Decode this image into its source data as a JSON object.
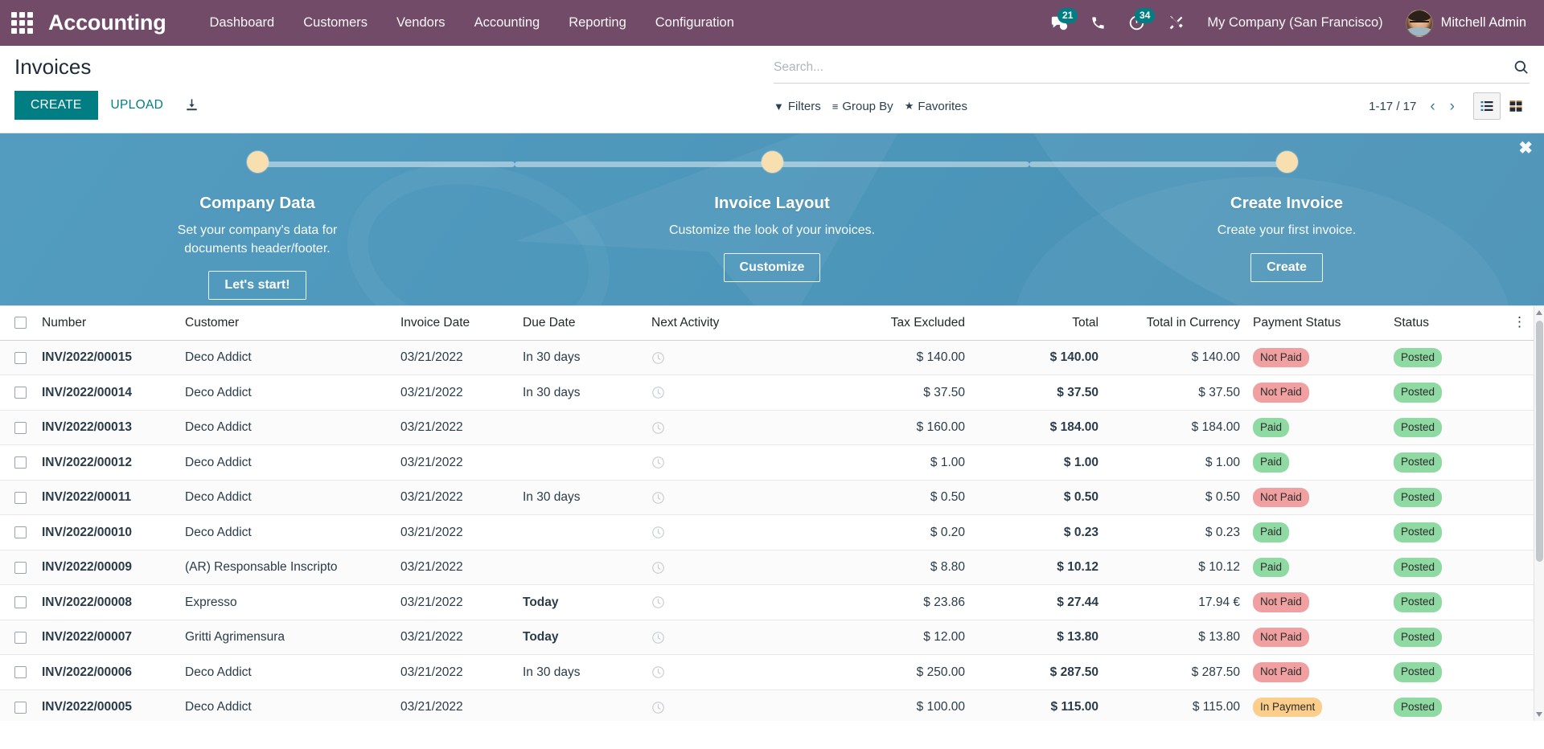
{
  "navbar": {
    "apps_icon": "apps-grid-icon",
    "brand": "Accounting",
    "menus": [
      {
        "label": "Dashboard"
      },
      {
        "label": "Customers"
      },
      {
        "label": "Vendors"
      },
      {
        "label": "Accounting"
      },
      {
        "label": "Reporting"
      },
      {
        "label": "Configuration"
      }
    ],
    "messages_count": "21",
    "activities_count": "34",
    "company": "My Company (San Francisco)",
    "user": "Mitchell Admin"
  },
  "control_panel": {
    "title": "Invoices",
    "create_label": "CREATE",
    "upload_label": "UPLOAD",
    "search_placeholder": "Search...",
    "filters_label": "Filters",
    "group_by_label": "Group By",
    "favorites_label": "Favorites",
    "pager": "1-17 / 17",
    "prev_arrow": "‹",
    "next_arrow": "›"
  },
  "onboarding": {
    "close_label": "✖",
    "steps": [
      {
        "title": "Company Data",
        "desc": "Set your company's data for documents header/footer.",
        "button": "Let's start!"
      },
      {
        "title": "Invoice Layout",
        "desc": "Customize the look of your invoices.",
        "button": "Customize"
      },
      {
        "title": "Create Invoice",
        "desc": "Create your first invoice.",
        "button": "Create"
      }
    ]
  },
  "table": {
    "columns": [
      "Number",
      "Customer",
      "Invoice Date",
      "Due Date",
      "Next Activity",
      "Tax Excluded",
      "Total",
      "Total in Currency",
      "Payment Status",
      "Status"
    ],
    "rows": [
      {
        "number": "INV/2022/00015",
        "customer": "Deco Addict",
        "invoice_date": "03/21/2022",
        "due_date": "In 30 days",
        "due_today": false,
        "tax_excluded": "$ 140.00",
        "total": "$ 140.00",
        "total_currency": "$ 140.00",
        "payment_status": "Not Paid",
        "payment_class": "notpaid",
        "status": "Posted"
      },
      {
        "number": "INV/2022/00014",
        "customer": "Deco Addict",
        "invoice_date": "03/21/2022",
        "due_date": "In 30 days",
        "due_today": false,
        "tax_excluded": "$ 37.50",
        "total": "$ 37.50",
        "total_currency": "$ 37.50",
        "payment_status": "Not Paid",
        "payment_class": "notpaid",
        "status": "Posted"
      },
      {
        "number": "INV/2022/00013",
        "customer": "Deco Addict",
        "invoice_date": "03/21/2022",
        "due_date": "",
        "due_today": false,
        "tax_excluded": "$ 160.00",
        "total": "$ 184.00",
        "total_currency": "$ 184.00",
        "payment_status": "Paid",
        "payment_class": "paid",
        "status": "Posted"
      },
      {
        "number": "INV/2022/00012",
        "customer": "Deco Addict",
        "invoice_date": "03/21/2022",
        "due_date": "",
        "due_today": false,
        "tax_excluded": "$ 1.00",
        "total": "$ 1.00",
        "total_currency": "$ 1.00",
        "payment_status": "Paid",
        "payment_class": "paid",
        "status": "Posted"
      },
      {
        "number": "INV/2022/00011",
        "customer": "Deco Addict",
        "invoice_date": "03/21/2022",
        "due_date": "In 30 days",
        "due_today": false,
        "tax_excluded": "$ 0.50",
        "total": "$ 0.50",
        "total_currency": "$ 0.50",
        "payment_status": "Not Paid",
        "payment_class": "notpaid",
        "status": "Posted"
      },
      {
        "number": "INV/2022/00010",
        "customer": "Deco Addict",
        "invoice_date": "03/21/2022",
        "due_date": "",
        "due_today": false,
        "tax_excluded": "$ 0.20",
        "total": "$ 0.23",
        "total_currency": "$ 0.23",
        "payment_status": "Paid",
        "payment_class": "paid",
        "status": "Posted"
      },
      {
        "number": "INV/2022/00009",
        "customer": "(AR) Responsable Inscripto",
        "invoice_date": "03/21/2022",
        "due_date": "",
        "due_today": false,
        "tax_excluded": "$ 8.80",
        "total": "$ 10.12",
        "total_currency": "$ 10.12",
        "payment_status": "Paid",
        "payment_class": "paid",
        "status": "Posted"
      },
      {
        "number": "INV/2022/00008",
        "customer": "Expresso",
        "invoice_date": "03/21/2022",
        "due_date": "Today",
        "due_today": true,
        "tax_excluded": "$ 23.86",
        "total": "$ 27.44",
        "total_currency": "17.94 €",
        "payment_status": "Not Paid",
        "payment_class": "notpaid",
        "status": "Posted"
      },
      {
        "number": "INV/2022/00007",
        "customer": "Gritti Agrimensura",
        "invoice_date": "03/21/2022",
        "due_date": "Today",
        "due_today": true,
        "tax_excluded": "$ 12.00",
        "total": "$ 13.80",
        "total_currency": "$ 13.80",
        "payment_status": "Not Paid",
        "payment_class": "notpaid",
        "status": "Posted"
      },
      {
        "number": "INV/2022/00006",
        "customer": "Deco Addict",
        "invoice_date": "03/21/2022",
        "due_date": "In 30 days",
        "due_today": false,
        "tax_excluded": "$ 250.00",
        "total": "$ 287.50",
        "total_currency": "$ 287.50",
        "payment_status": "Not Paid",
        "payment_class": "notpaid",
        "status": "Posted"
      },
      {
        "number": "INV/2022/00005",
        "customer": "Deco Addict",
        "invoice_date": "03/21/2022",
        "due_date": "",
        "due_today": false,
        "tax_excluded": "$ 100.00",
        "total": "$ 115.00",
        "total_currency": "$ 115.00",
        "payment_status": "In Payment",
        "payment_class": "inpayment",
        "status": "Posted"
      }
    ]
  },
  "colors": {
    "navbar": "#714B67",
    "accent": "#017e84",
    "banner": "#4a97bd",
    "badge_paid": "#8fd9a2",
    "badge_notpaid": "#f0a0a0",
    "badge_inpayment": "#fbce8b"
  }
}
